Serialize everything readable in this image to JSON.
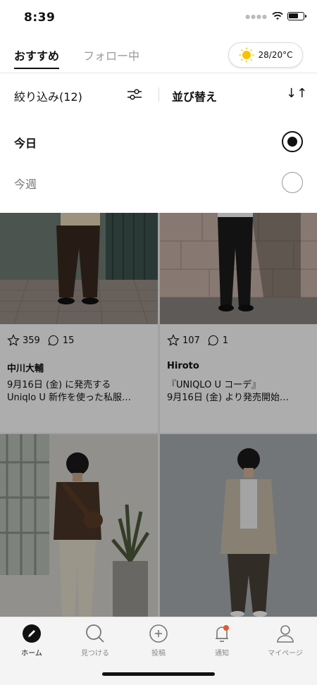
{
  "status": {
    "time": "8:39",
    "battery_level": 0.7
  },
  "tabs": {
    "active": "おすすめ",
    "inactive": "フォロー中"
  },
  "weather": {
    "temp": "28/20°C",
    "icon": "sun-icon"
  },
  "filter": {
    "label": "絞り込み(12)",
    "sort_label": "並び替え",
    "filter_icon": "sliders-icon",
    "sort_icon": "sort-arrows-icon",
    "sort_glyph": "↓↑"
  },
  "options": [
    {
      "label": "今日",
      "selected": true
    },
    {
      "label": "今週",
      "selected": false
    }
  ],
  "cards": [
    {
      "likes": "359",
      "comments": "15",
      "author": "中川大輔",
      "desc_line1": "9月16日 (金) に発売する",
      "desc_line2": "Uniqlo U 新作を使った私服…"
    },
    {
      "likes": "107",
      "comments": "1",
      "author": "Hiroto",
      "desc_line1": "『UNIQLO U コーデ』",
      "desc_line2": "9月16日 (金) より発売開始…"
    }
  ],
  "nav": [
    {
      "label": "ホーム",
      "icon": "home-pencil-icon"
    },
    {
      "label": "見つける",
      "icon": "search-icon"
    },
    {
      "label": "投稿",
      "icon": "plus-circle-icon"
    },
    {
      "label": "通知",
      "icon": "bell-icon"
    },
    {
      "label": "マイページ",
      "icon": "user-icon"
    }
  ],
  "colors": {
    "accent": "#111111",
    "overlay": "#000000",
    "notification_dot": "#e05a2b",
    "sun": "#f5c400"
  }
}
